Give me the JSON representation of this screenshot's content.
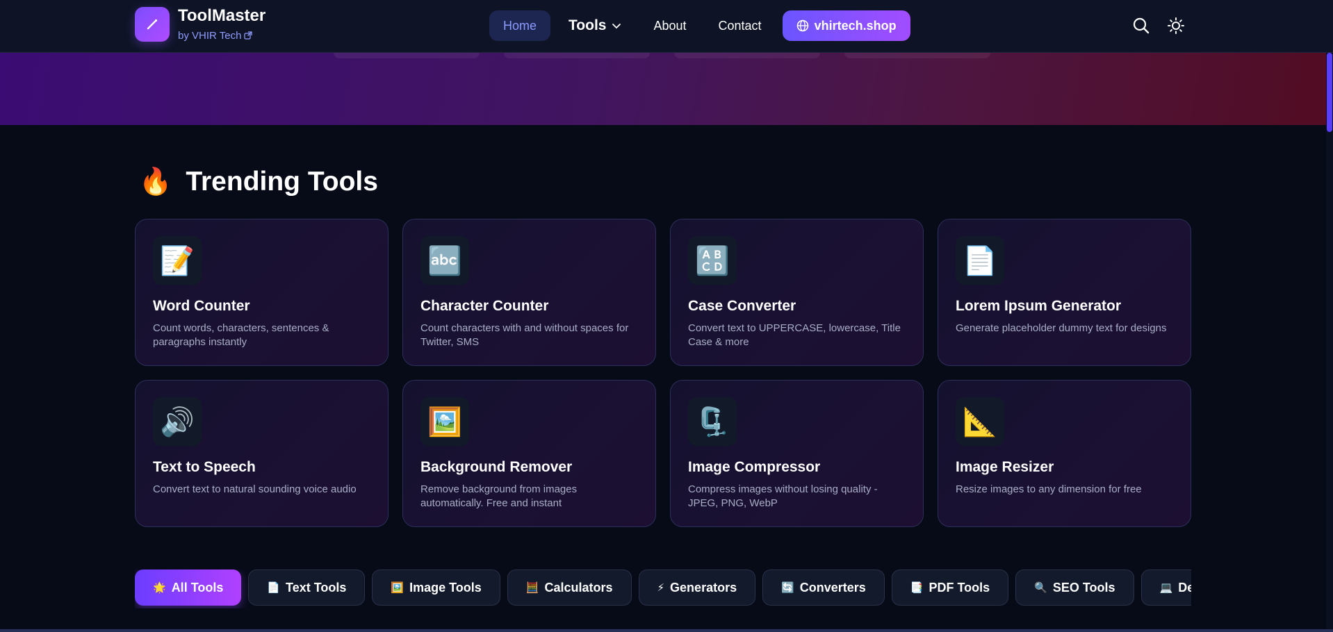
{
  "brand": {
    "name": "ToolMaster",
    "sub": "by VHIR Tech"
  },
  "nav": {
    "home": "Home",
    "tools": "Tools",
    "about": "About",
    "contact": "Contact",
    "shop": "vhirtech.shop"
  },
  "section": {
    "emoji": "🔥",
    "title": "Trending Tools"
  },
  "cards": [
    {
      "icon": "📝",
      "title": "Word Counter",
      "desc": "Count words, characters, sentences & paragraphs instantly"
    },
    {
      "icon": "🔤",
      "title": "Character Counter",
      "desc": "Count characters with and without spaces for Twitter, SMS"
    },
    {
      "icon": "🔠",
      "title": "Case Converter",
      "desc": "Convert text to UPPERCASE, lowercase, Title Case & more"
    },
    {
      "icon": "📄",
      "title": "Lorem Ipsum Generator",
      "desc": "Generate placeholder dummy text for designs"
    },
    {
      "icon": "🔊",
      "title": "Text to Speech",
      "desc": "Convert text to natural sounding voice audio"
    },
    {
      "icon": "🖼️",
      "title": "Background Remover",
      "desc": "Remove background from images automatically. Free and instant"
    },
    {
      "icon": "🗜️",
      "title": "Image Compressor",
      "desc": "Compress images without losing quality - JPEG, PNG, WebP"
    },
    {
      "icon": "📐",
      "title": "Image Resizer",
      "desc": "Resize images to any dimension for free"
    }
  ],
  "categories": [
    {
      "icon": "🌟",
      "label": "All Tools"
    },
    {
      "icon": "📄",
      "label": "Text Tools"
    },
    {
      "icon": "🖼️",
      "label": "Image Tools"
    },
    {
      "icon": "🧮",
      "label": "Calculators"
    },
    {
      "icon": "⚡",
      "label": "Generators"
    },
    {
      "icon": "🔄",
      "label": "Converters"
    },
    {
      "icon": "📑",
      "label": "PDF Tools"
    },
    {
      "icon": "🔍",
      "label": "SEO Tools"
    },
    {
      "icon": "💻",
      "label": "Dev"
    }
  ],
  "colors": {
    "accent": "#7b4dff",
    "background": "#070b18",
    "header": "#0e1426"
  }
}
